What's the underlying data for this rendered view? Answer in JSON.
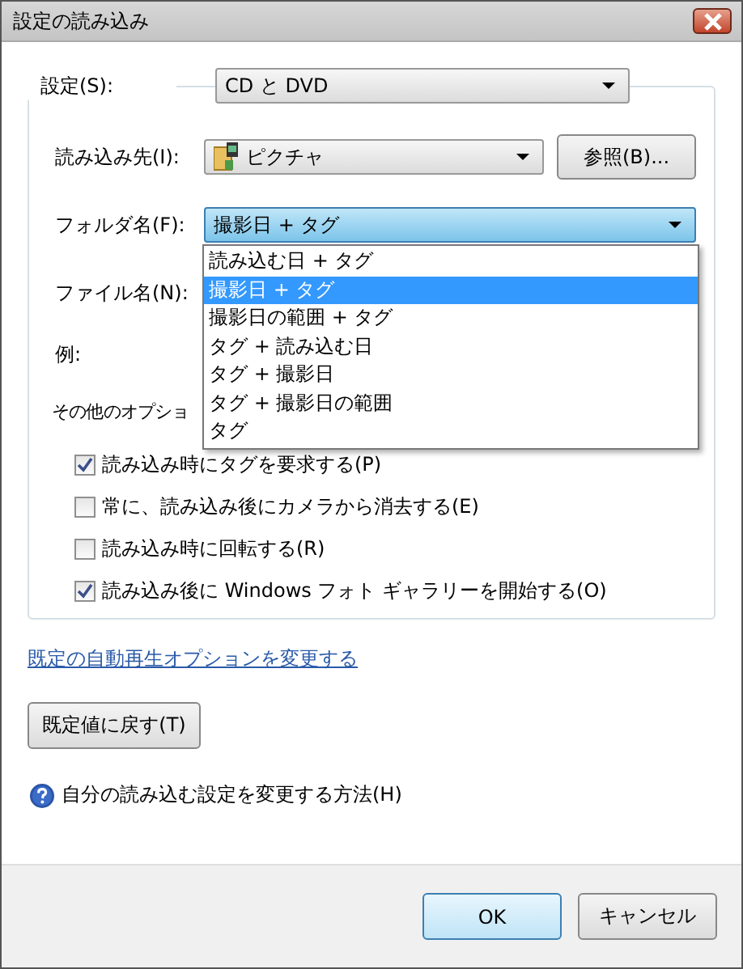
{
  "window": {
    "title": "設定の読み込み"
  },
  "settings": {
    "label": "設定(S):",
    "value": "CD と DVD"
  },
  "destination": {
    "label": "読み込み先(I):",
    "value": "ピクチャ",
    "browse_button": "参照(B)..."
  },
  "folder_name": {
    "label": "フォルダ名(F):",
    "value": "撮影日 + タグ",
    "expanded": true,
    "options": [
      {
        "label": "読み込む日 + タグ",
        "selected": false
      },
      {
        "label": "撮影日 + タグ",
        "selected": true
      },
      {
        "label": "撮影日の範囲 + タグ",
        "selected": false
      },
      {
        "label": "タグ + 読み込む日",
        "selected": false
      },
      {
        "label": "タグ + 撮影日",
        "selected": false
      },
      {
        "label": "タグ + 撮影日の範囲",
        "selected": false
      },
      {
        "label": "タグ",
        "selected": false
      }
    ]
  },
  "file_name": {
    "label": "ファイル名(N):"
  },
  "example": {
    "label": "例:"
  },
  "other_options": {
    "label": "その他のオプショ"
  },
  "checkboxes": [
    {
      "label": "読み込み時にタグを要求する(P)",
      "checked": true
    },
    {
      "label": "常に、読み込み後にカメラから消去する(E)",
      "checked": false
    },
    {
      "label": "読み込み時に回転する(R)",
      "checked": false
    },
    {
      "label": "読み込み後に Windows フォト ギャラリーを開始する(O)",
      "checked": true
    }
  ],
  "autoplay_link": "既定の自動再生オプションを変更する",
  "reset_button": "既定値に戻す(T)",
  "help_link": "自分の読み込む設定を変更する方法(H)",
  "buttons": [
    {
      "label": "OK",
      "default": true
    },
    {
      "label": "キャンセル",
      "default": false
    }
  ]
}
